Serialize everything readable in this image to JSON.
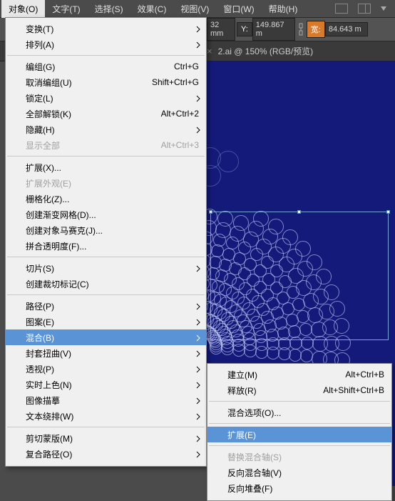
{
  "menubar": {
    "items": [
      "对象(O)",
      "文字(T)",
      "选择(S)",
      "效果(C)",
      "视图(V)",
      "窗口(W)",
      "帮助(H)"
    ]
  },
  "toolbar": {
    "val1": "32 mm",
    "y_label": "Y:",
    "y_val": "149.867 m",
    "w_label": "宽:",
    "w_val": "84.643 m"
  },
  "tab": {
    "close": "×",
    "label": "2.ai @ 150% (RGB/预览)"
  },
  "menu": {
    "transform": "变换(T)",
    "arrange": "排列(A)",
    "group": "编组(G)",
    "group_s": "Ctrl+G",
    "ungroup": "取消编组(U)",
    "ungroup_s": "Shift+Ctrl+G",
    "lock": "锁定(L)",
    "unlockall": "全部解锁(K)",
    "unlockall_s": "Alt+Ctrl+2",
    "hide": "隐藏(H)",
    "showall": "显示全部",
    "showall_s": "Alt+Ctrl+3",
    "expand": "扩展(X)...",
    "expandapp": "扩展外观(E)",
    "rasterize": "栅格化(Z)...",
    "gradmesh": "创建渐变网格(D)...",
    "mosaic": "创建对象马赛克(J)...",
    "flatten": "拼合透明度(F)...",
    "slice": "切片(S)",
    "cropmarks": "创建裁切标记(C)",
    "path": "路径(P)",
    "pattern": "图案(E)",
    "blend": "混合(B)",
    "envelope": "封套扭曲(V)",
    "perspective": "透视(P)",
    "livepaint": "实时上色(N)",
    "imagetrace": "图像描摹",
    "textwrap": "文本绕排(W)",
    "clipmask": "剪切蒙版(M)",
    "compound": "复合路径(O)"
  },
  "submenu": {
    "make": "建立(M)",
    "make_s": "Alt+Ctrl+B",
    "release": "释放(R)",
    "release_s": "Alt+Shift+Ctrl+B",
    "options": "混合选项(O)...",
    "expand": "扩展(E)",
    "replace": "替换混合轴(S)",
    "reverse": "反向混合轴(V)",
    "reversefb": "反向堆叠(F)"
  }
}
